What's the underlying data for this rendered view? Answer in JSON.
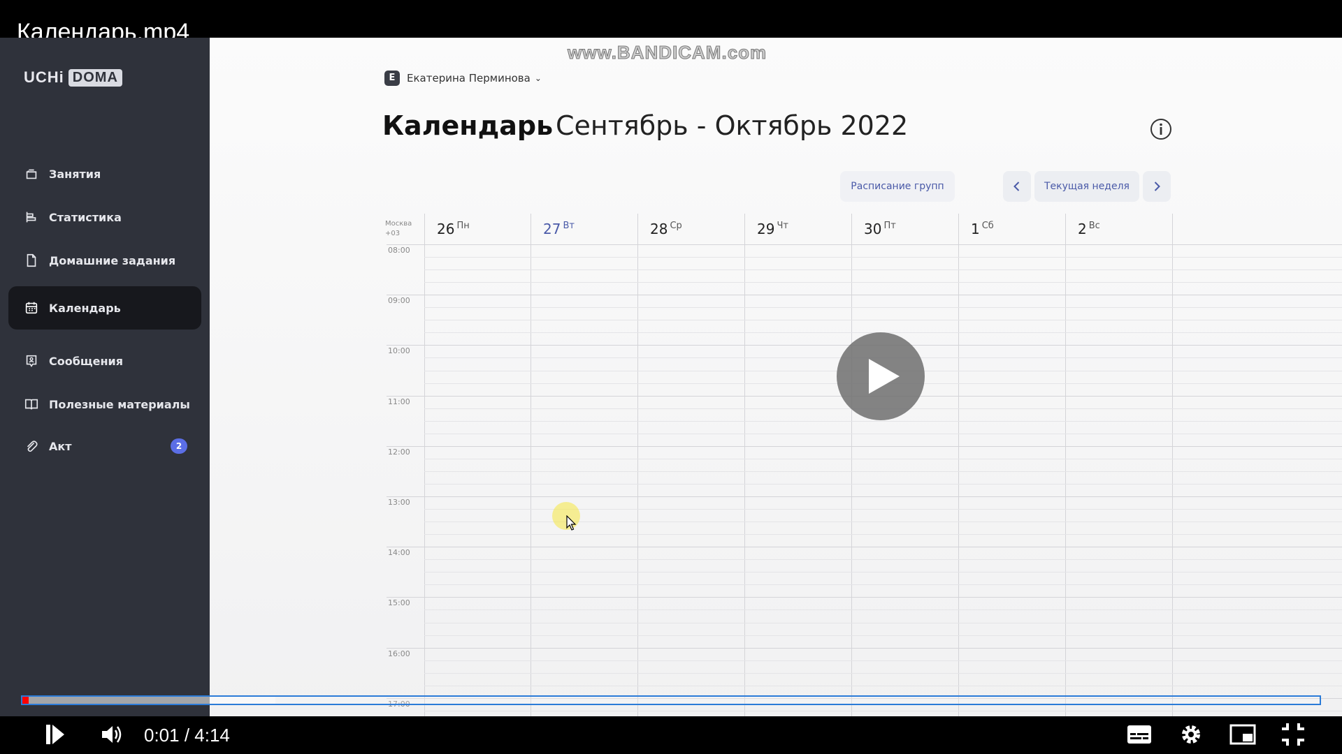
{
  "video": {
    "title": "Календарь.mp4",
    "watermark": "www.BANDICAM.com",
    "current_time": "0:01",
    "duration": "4:14",
    "time_display": "0:01 / 4:14",
    "progress_played_fraction": 0.005,
    "progress_loaded_fraction": 0.195
  },
  "sidebar": {
    "logo_text": "UCHi",
    "logo_box": "DOMA",
    "items": [
      {
        "label": "Занятия",
        "icon": "lessons-icon",
        "active": false
      },
      {
        "label": "Статистика",
        "icon": "statistics-icon",
        "active": false
      },
      {
        "label": "Домашние задания",
        "icon": "homework-icon",
        "active": false
      },
      {
        "label": "Календарь",
        "icon": "calendar-icon",
        "active": true
      },
      {
        "label": "Сообщения",
        "icon": "messages-icon",
        "active": false
      },
      {
        "label": "Полезные материалы",
        "icon": "book-icon",
        "active": false
      },
      {
        "label": "Акт",
        "icon": "paperclip-icon",
        "active": false,
        "badge": "2"
      }
    ]
  },
  "header": {
    "user_initial": "Е",
    "user_name": "Екатерина Перминова",
    "page_title": "Календарь",
    "period": "Сентябрь - Октябрь 2022"
  },
  "toolbar": {
    "groups_schedule": "Расписание групп",
    "current_week": "Текущая неделя"
  },
  "calendar": {
    "timezone_line1": "Москва",
    "timezone_line2": "+03",
    "days": [
      {
        "num": "26",
        "wd": "Пн",
        "today": false
      },
      {
        "num": "27",
        "wd": "Вт",
        "today": true
      },
      {
        "num": "28",
        "wd": "Ср",
        "today": false
      },
      {
        "num": "29",
        "wd": "Чт",
        "today": false
      },
      {
        "num": "30",
        "wd": "Пт",
        "today": false
      },
      {
        "num": "1",
        "wd": "Сб",
        "today": false
      },
      {
        "num": "2",
        "wd": "Вс",
        "today": false
      }
    ],
    "hours": [
      "08:00",
      "09:00",
      "10:00",
      "11:00",
      "12:00",
      "13:00",
      "14:00",
      "15:00",
      "16:00",
      "17:00"
    ]
  },
  "colors": {
    "accent": "#4a5aa8",
    "sidebar_bg": "#2f323b",
    "badge": "#5b6ee6",
    "progress_played": "#ff0000"
  }
}
